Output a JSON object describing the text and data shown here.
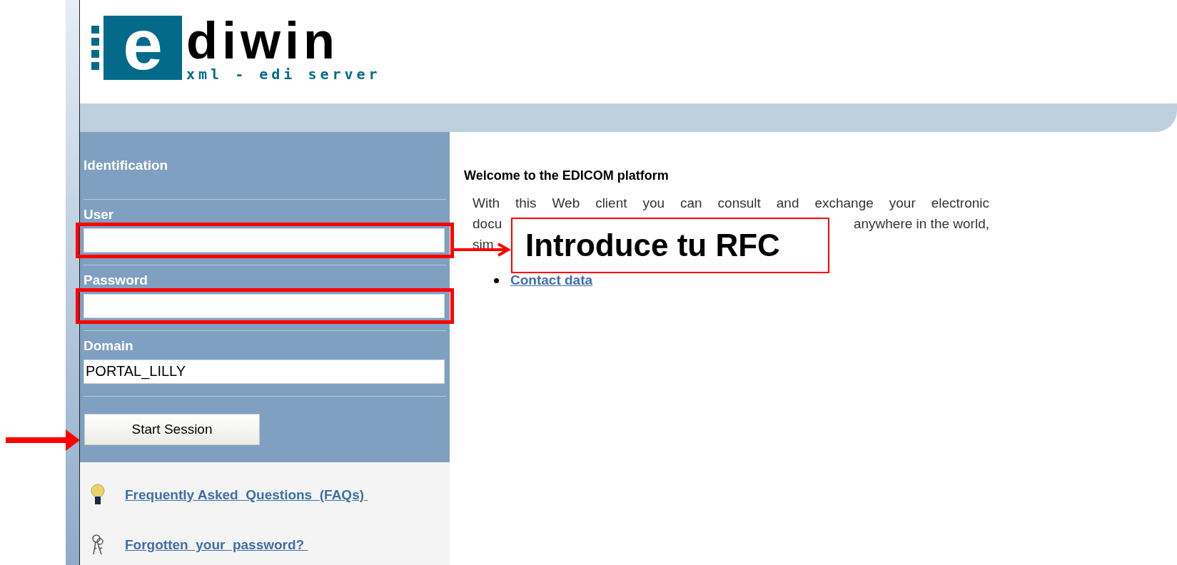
{
  "logo": {
    "mark": "e",
    "name": "diwin",
    "tagline": "xml - edi server"
  },
  "login": {
    "title": "Identification",
    "fields": [
      {
        "label": "User",
        "highlighted": true
      },
      {
        "label": "Password",
        "highlighted": true
      },
      {
        "label": "Domain",
        "value": "PORTAL_LILLY",
        "highlighted": false
      }
    ],
    "button": "Start Session",
    "button_pointed": true
  },
  "help_links": [
    {
      "kind": "faq",
      "label": "Frequently Asked  Questions  (FAQs) "
    },
    {
      "kind": "password",
      "label": "Forgotten  your  password? "
    }
  ],
  "welcome": {
    "title": "Welcome to the EDICOM platform",
    "lines": [
      {
        "left": "With this Web client you can consult and exchange your electronic"
      },
      {
        "left": "docu",
        "right": "anywhere in the world,"
      },
      {
        "left": "sim"
      }
    ],
    "links": [
      "Contact data"
    ]
  },
  "callout": {
    "text": "Introduce tu RFC"
  }
}
